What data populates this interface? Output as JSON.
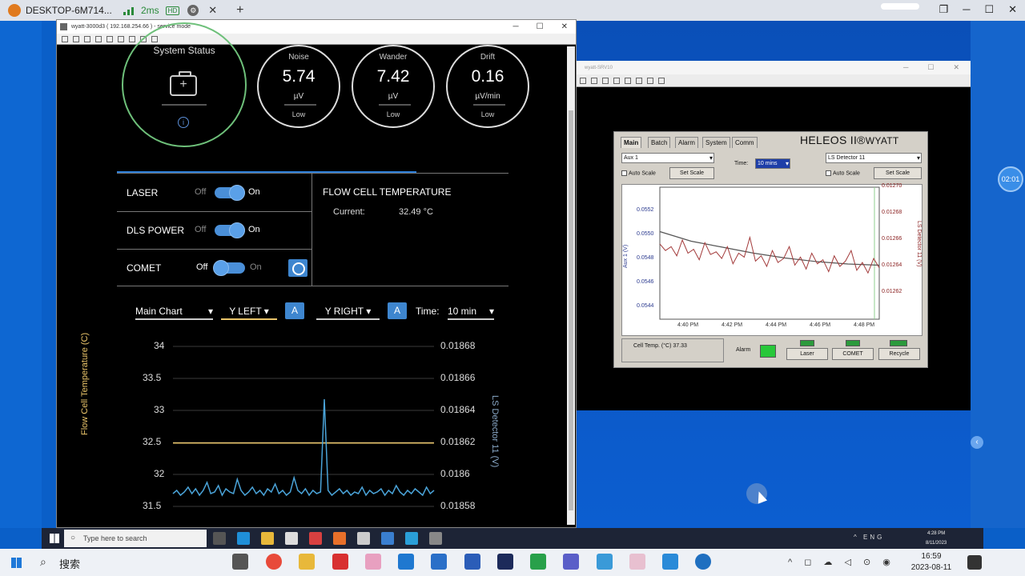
{
  "client": {
    "tab_title": "DESKTOP-6M714...",
    "latency": "2ms",
    "hd_badge": "HD",
    "close": "✕",
    "new_tab": "+",
    "window_controls": [
      "❐",
      "─",
      "☐",
      "✕"
    ]
  },
  "remote_window": {
    "title": "wyatt-3000d3 ( 192.168.254.66 ) - service mode",
    "controls": [
      "─",
      "☐",
      "✕"
    ]
  },
  "system_status": {
    "title": "System Status",
    "info": "i",
    "gauges": [
      {
        "name": "Noise",
        "value": "5.74",
        "unit": "µV",
        "level": "Low"
      },
      {
        "name": "Wander",
        "value": "7.42",
        "unit": "µV",
        "level": "Low"
      },
      {
        "name": "Drift",
        "value": "0.16",
        "unit": "µV/min",
        "level": "Low"
      }
    ]
  },
  "controls": {
    "off": "Off",
    "on": "On",
    "rows": [
      {
        "label": "LASER",
        "state": "On"
      },
      {
        "label": "DLS POWER",
        "state": "On"
      },
      {
        "label": "COMET",
        "state": "Off"
      }
    ]
  },
  "flow_cell": {
    "title": "FLOW CELL TEMPERATURE",
    "current_label": "Current:",
    "current_value": "32.49 °C"
  },
  "chart_toolbar": {
    "main": "Main Chart",
    "y_left": "Y LEFT",
    "y_right": "Y RIGHT",
    "a_btn": "A",
    "time_label": "Time:",
    "time_value": "10 min"
  },
  "chart_data": [
    {
      "type": "line",
      "ylabel_left": "Flow Cell Temperature (C)",
      "ylabel_right": "LS Detector 11 (V)",
      "ylim_left": [
        31.5,
        34
      ],
      "ylim_right": [
        0.01858,
        0.01868
      ],
      "yticks_left": [
        "34",
        "33.5",
        "33",
        "32.5",
        "32",
        "31.5"
      ],
      "yticks_right": [
        "0.01868",
        "0.01866",
        "0.01864",
        "0.01862",
        "0.0186",
        "0.01858"
      ],
      "grid": true,
      "series": [
        {
          "name": "Flow Cell Temperature (C)",
          "color": "#e9c46a",
          "axis": "left",
          "values": [
            32.49,
            32.49
          ]
        },
        {
          "name": "LS Detector 11 (V)",
          "color": "#4aa3d8",
          "axis": "right",
          "values": [
            0.018588,
            0.01859,
            0.018587,
            0.018589,
            0.018592,
            0.018588,
            0.018591,
            0.018587,
            0.01859,
            0.018595,
            0.018588,
            0.018589,
            0.018593,
            0.018587,
            0.018591,
            0.018589,
            0.018588,
            0.018597,
            0.01859,
            0.018587,
            0.018589,
            0.018592,
            0.018588,
            0.01859,
            0.018587,
            0.018591,
            0.018589,
            0.018594,
            0.018588,
            0.01859,
            0.018587,
            0.018589,
            0.018598,
            0.01859,
            0.018588,
            0.018591,
            0.018587,
            0.01859,
            0.018588,
            0.018589,
            0.018647,
            0.01859,
            0.018587,
            0.018589,
            0.018591,
            0.018588,
            0.01859,
            0.018587,
            0.018589,
            0.018588,
            0.018592,
            0.018587,
            0.01859,
            0.018588,
            0.018589,
            0.018591,
            0.018587,
            0.01859,
            0.018588,
            0.018593,
            0.018589,
            0.018587,
            0.01859,
            0.018588,
            0.018591,
            0.018589,
            0.018587,
            0.018592,
            0.018588,
            0.01859
          ]
        }
      ]
    },
    {
      "type": "line",
      "ylabel_left": "Aux 1 (V)",
      "ylabel_right": "LS Detector 11 (V)",
      "ylim_left": [
        0.0543,
        0.0554
      ],
      "ylim_right": [
        0.0126,
        0.0127
      ],
      "yticks_left": [
        "0.0552",
        "0.0550",
        "0.0548",
        "0.0546",
        "0.0544"
      ],
      "yticks_right": [
        "0.01270",
        "0.01268",
        "0.01266",
        "0.01264",
        "0.01262"
      ],
      "x": [
        "4:40 PM",
        "4:42 PM",
        "4:44 PM",
        "4:46 PM",
        "4:48 PM"
      ],
      "series": [
        {
          "name": "Aux 1 (V)",
          "color": "#555555",
          "values": [
            0.05503,
            0.05495,
            0.0549,
            0.05485,
            0.05481,
            0.05478,
            0.05476,
            0.05475
          ]
        },
        {
          "name": "LS Detector 11 (V)",
          "color": "#a33b3b",
          "values": [
            0.012657,
            0.012652,
            0.012655,
            0.012648,
            0.01266,
            0.01265,
            0.012653,
            0.012645,
            0.012658,
            0.012649,
            0.012651,
            0.012646,
            0.012655,
            0.012642,
            0.01265,
            0.012647,
            0.012662,
            0.012644,
            0.012648,
            0.01264,
            0.012652,
            0.012643,
            0.012646,
            0.012655,
            0.012641,
            0.012647,
            0.012638,
            0.01265,
            0.012642,
            0.012645,
            0.012636,
            0.012648,
            0.01264,
            0.012644,
            0.012652,
            0.012637,
            0.012643,
            0.012635,
            0.012646,
            0.012639
          ]
        }
      ]
    }
  ],
  "heleos": {
    "window_title": "wyatt-SRV10",
    "controls": [
      "─",
      "☐",
      "✕"
    ],
    "tabs": [
      "Main",
      "Batch",
      "Alarm",
      "System",
      "Comm"
    ],
    "logo": "HELEOS II",
    "logo_mark": "®",
    "logo_brand": "WYATT",
    "left_select": "Aux 1",
    "right_select": "LS Detector 11",
    "auto_scale": "Auto Scale",
    "set_scale": "Set Scale",
    "time_label": "Time:",
    "time_value": "10 mins",
    "cell_temp": "Cell Temp. (°C) 37.33",
    "alarm": "Alarm",
    "laser": "Laser",
    "comet": "COMET",
    "recycle": "Recycle",
    "ylabel_left": "Aux 1 (V)",
    "ylabel_right": "LS Detector 11 (V)"
  },
  "timer_badge": "02:01",
  "inner_taskbar": {
    "search_placeholder": "Type here to search",
    "tray": "^ ENG",
    "time": "4:28 PM",
    "date": "8/11/2023"
  },
  "outer_taskbar": {
    "search": "搜索",
    "time": "16:59",
    "date": "2023-08-11"
  }
}
